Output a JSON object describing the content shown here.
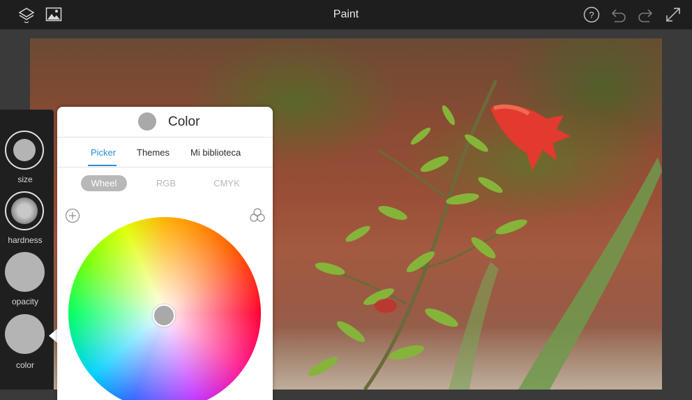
{
  "app": {
    "title": "Paint"
  },
  "topbar_icons": [
    "layers-icon",
    "photo-icon",
    "help-icon",
    "undo-icon",
    "redo-icon",
    "fullscreen-icon"
  ],
  "tools": [
    {
      "label": "size"
    },
    {
      "label": "hardness"
    },
    {
      "label": "opacity"
    },
    {
      "label": "color"
    }
  ],
  "color_panel": {
    "title": "Color",
    "current_color": "#a9a9a9",
    "tabs": [
      "Picker",
      "Themes",
      "Mi biblioteca"
    ],
    "active_tab": "Picker",
    "modes": [
      "Wheel",
      "RGB",
      "CMYK"
    ],
    "active_mode": "Wheel",
    "accent_color": "#2a8cd6"
  }
}
